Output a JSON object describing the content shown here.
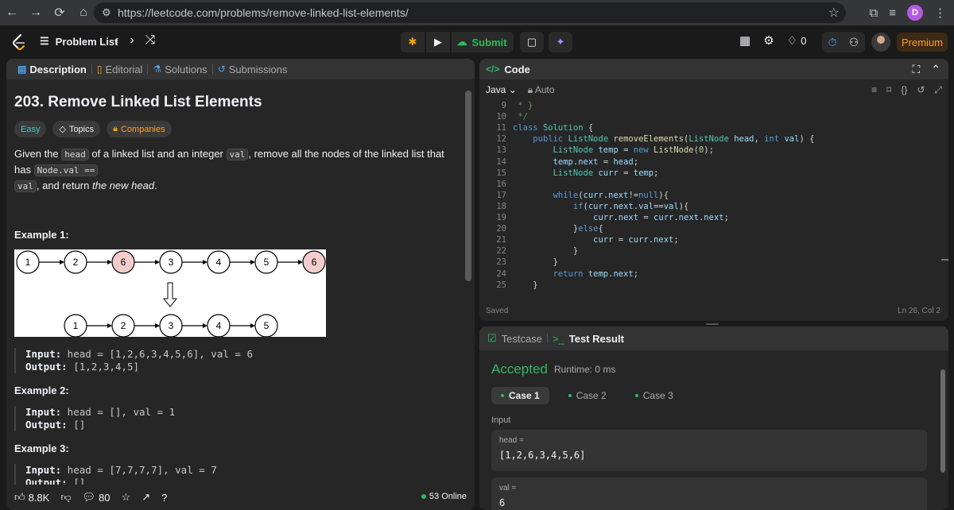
{
  "browser": {
    "url": "https://leetcode.com/problems/remove-linked-list-elements/",
    "profile_initial": "D"
  },
  "topbar": {
    "problem_list": "Problem List",
    "submit": "Submit",
    "notification_count": "0",
    "premium": "Premium"
  },
  "left_tabs": {
    "description": "Description",
    "editorial": "Editorial",
    "solutions": "Solutions",
    "submissions": "Submissions"
  },
  "problem": {
    "title": "203. Remove Linked List Elements",
    "tags": {
      "difficulty": "Easy",
      "topics": "Topics",
      "companies": "Companies"
    },
    "statement": {
      "p1": "Given the ",
      "c1": "head",
      "p2": " of a linked list and an integer ",
      "c2": "val",
      "p3": ", remove all the nodes of the linked list that has ",
      "c3": "Node.val ==",
      "c4": "val",
      "p4": ", and return ",
      "em": "the new head",
      "p5": "."
    },
    "examples": [
      {
        "heading": "Example 1:",
        "input_label": "Input:",
        "input": " head = [1,2,6,3,4,5,6], val = 6",
        "output_label": "Output:",
        "output": " [1,2,3,4,5]"
      },
      {
        "heading": "Example 2:",
        "input_label": "Input:",
        "input": " head = [], val = 1",
        "output_label": "Output:",
        "output": " []"
      },
      {
        "heading": "Example 3:",
        "input_label": "Input:",
        "input": " head = [7,7,7,7], val = 7",
        "output_label": "Output:",
        "output": " []"
      }
    ],
    "diagram": {
      "top_nodes": [
        "1",
        "2",
        "6",
        "3",
        "4",
        "5",
        "6"
      ],
      "removed_value": "6",
      "bottom_nodes": [
        "1",
        "2",
        "3",
        "4",
        "5"
      ]
    }
  },
  "left_footer": {
    "likes": "8.8K",
    "comments": "80",
    "online": "53 Online"
  },
  "code_panel": {
    "title": "Code",
    "language": "Java",
    "mode": "Auto",
    "status": "Saved",
    "cursor": "Ln 26, Col 2",
    "lines": [
      {
        "n": "9",
        "html": "<span class=\"cm\"> * }</span>"
      },
      {
        "n": "10",
        "html": "<span class=\"cm\"> */</span>"
      },
      {
        "n": "11",
        "html": "<span class=\"kw\">class</span> <span class=\"ty\">Solution</span> {"
      },
      {
        "n": "12",
        "html": "    <span class=\"kw\">public</span> <span class=\"ty\">ListNode</span> <span class=\"fn\">removeElements</span>(<span class=\"ty\">ListNode</span> <span class=\"vr\">head</span>, <span class=\"kw\">int</span> <span class=\"vr\">val</span>) {"
      },
      {
        "n": "13",
        "html": "        <span class=\"ty\">ListNode</span> <span class=\"vr\">temp</span> = <span class=\"kw\">new</span> <span class=\"fn\">ListNode</span>(<span class=\"nm\">0</span>);"
      },
      {
        "n": "14",
        "html": "        <span class=\"vr\">temp</span>.<span class=\"vr\">next</span> = <span class=\"vr\">head</span>;"
      },
      {
        "n": "15",
        "html": "        <span class=\"ty\">ListNode</span> <span class=\"vr\">curr</span> = <span class=\"vr\">temp</span>;"
      },
      {
        "n": "16",
        "html": ""
      },
      {
        "n": "17",
        "html": "        <span class=\"kw\">while</span>(<span class=\"vr\">curr</span>.<span class=\"vr\">next</span>!=<span class=\"kw\">null</span>){"
      },
      {
        "n": "18",
        "html": "            <span class=\"kw\">if</span>(<span class=\"vr\">curr</span>.<span class=\"vr\">next</span>.<span class=\"vr\">val</span>==<span class=\"vr\">val</span>){"
      },
      {
        "n": "19",
        "html": "                <span class=\"vr\">curr</span>.<span class=\"vr\">next</span> = <span class=\"vr\">curr</span>.<span class=\"vr\">next</span>.<span class=\"vr\">next</span>;"
      },
      {
        "n": "20",
        "html": "            }<span class=\"kw\">else</span>{"
      },
      {
        "n": "21",
        "html": "                <span class=\"vr\">curr</span> = <span class=\"vr\">curr</span>.<span class=\"vr\">next</span>;"
      },
      {
        "n": "22",
        "html": "            }"
      },
      {
        "n": "23",
        "html": "        }"
      },
      {
        "n": "24",
        "html": "        <span class=\"kw\">return</span> <span class=\"vr\">temp</span>.<span class=\"vr\">next</span>;"
      },
      {
        "n": "25",
        "html": "    }"
      }
    ]
  },
  "test_panel": {
    "tab_testcase": "Testcase",
    "tab_result": "Test Result",
    "verdict": "Accepted",
    "runtime": "Runtime: 0 ms",
    "cases": [
      "Case 1",
      "Case 2",
      "Case 3"
    ],
    "input_label": "Input",
    "inputs": [
      {
        "key": "head =",
        "value": "[1,2,6,3,4,5,6]"
      },
      {
        "key": "val =",
        "value": "6"
      }
    ]
  },
  "colors": {
    "accent": "#ffa116",
    "green": "#2cbb5d",
    "bg": "#1a1a1a",
    "panel": "#262626"
  }
}
